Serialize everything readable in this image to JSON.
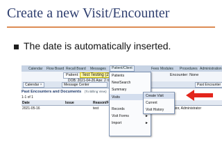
{
  "slide": {
    "title": "Create a new Visit/Encounter",
    "bullet": "The date is automatically inserted."
  },
  "colors": {
    "title": "#2E3E6F",
    "rule": "#DD8C54",
    "nav_bar": "#C7D3E4",
    "patient_highlight": "#FFF7A6",
    "arrow": "#E3261C"
  },
  "emr": {
    "nav": [
      "Calendar",
      "Flow Board",
      "Recall Board",
      "Messages",
      "Patient/Client",
      "Fees",
      "Modules",
      "Procedures",
      "Administration"
    ],
    "patient_label": "Patient:",
    "patient_name": "Test Testing (2)",
    "dob_line": "DOB: 2021-04-26 Age: 2 month",
    "encounter_text": "Encounter: None",
    "tabs": [
      "Calendar",
      "Message Center",
      "Past Encounter"
    ],
    "section_title": "Past Encounters and Documents",
    "billing_note": "(To Billing View)",
    "count_text": "1-1 of 1",
    "table": {
      "headers": [
        "Date",
        "Issue",
        "Reason/Form"
      ],
      "rows": [
        {
          "date": "2021-05-16",
          "issue": "",
          "reason": "test",
          "provider": "Administrator, Administrator"
        }
      ]
    },
    "patient_menu": {
      "items": [
        "Patients",
        "New/Search",
        "Summary",
        "Visits",
        "Records",
        "Visit Forms",
        "Import"
      ]
    },
    "visits_submenu": {
      "items": [
        "Create Visit",
        "Current",
        "Visit History"
      ]
    }
  }
}
